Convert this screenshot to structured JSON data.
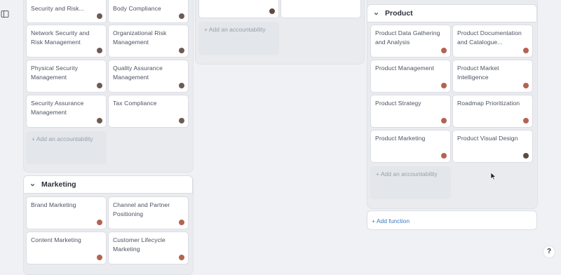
{
  "security_section": {
    "cards": [
      {
        "title": "Security and Risk..."
      },
      {
        "title": "Body Compliance"
      },
      {
        "title": "Network Security and Risk Management"
      },
      {
        "title": "Organizational Risk Management"
      },
      {
        "title": "Physical Security Management"
      },
      {
        "title": "Quality Assurance Management"
      },
      {
        "title": "Security Assurance Management"
      },
      {
        "title": "Tax Compliance"
      }
    ],
    "add_accountability": "+ Add an accountability"
  },
  "middle_section": {
    "add_accountability": "+ Add an accountability"
  },
  "marketing_section": {
    "title": "Marketing",
    "cards": [
      {
        "title": "Brand Marketing"
      },
      {
        "title": "Channel and Partner Positioning"
      },
      {
        "title": "Content Marketing"
      },
      {
        "title": "Customer Lifecycle Marketing"
      }
    ]
  },
  "product_section": {
    "title": "Product",
    "cards": [
      {
        "title": "Product Data Gathering and Analysis"
      },
      {
        "title": "Product Documentation and Catalogue..."
      },
      {
        "title": "Product Management"
      },
      {
        "title": "Product Market Intelligence"
      },
      {
        "title": "Product Strategy"
      },
      {
        "title": "Roadmap Prioritization"
      },
      {
        "title": "Product Marketing"
      },
      {
        "title": "Product Visual Design"
      }
    ],
    "add_accountability": "+ Add an accountability",
    "add_function": "+ Add function"
  },
  "help": {
    "label": "?"
  },
  "colors": {
    "accent": "#3a7bbf",
    "background": "#eff1f4"
  }
}
